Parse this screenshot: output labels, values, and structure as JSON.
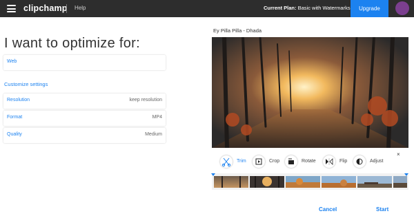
{
  "topbar": {
    "logo": "clipchamp",
    "help": "Help",
    "plan_label": "Current Plan:",
    "plan_value": "Basic with Watermarks",
    "upgrade": "Upgrade"
  },
  "optimize": {
    "heading": "I want to optimize for:",
    "target": "Web",
    "customize_title": "Customize settings",
    "settings": [
      {
        "label": "Resolution",
        "value": "keep resolution"
      },
      {
        "label": "Format",
        "value": "MP4"
      },
      {
        "label": "Quality",
        "value": "Medium"
      }
    ]
  },
  "preview": {
    "title": "Ey Pilla Pilla - Dhada",
    "tools": [
      {
        "label": "Trim",
        "icon": "scissors-icon"
      },
      {
        "label": "Crop",
        "icon": "crop-icon"
      },
      {
        "label": "Rotate",
        "icon": "rotate-icon"
      },
      {
        "label": "Flip",
        "icon": "flip-icon"
      },
      {
        "label": "Adjust",
        "icon": "adjust-icon"
      }
    ],
    "close": "×"
  },
  "actions": {
    "cancel": "Cancel",
    "start": "Start"
  },
  "colors": {
    "accent": "#1c82f0",
    "topbar": "#2d2d2d",
    "avatar": "#7b3f8f"
  }
}
